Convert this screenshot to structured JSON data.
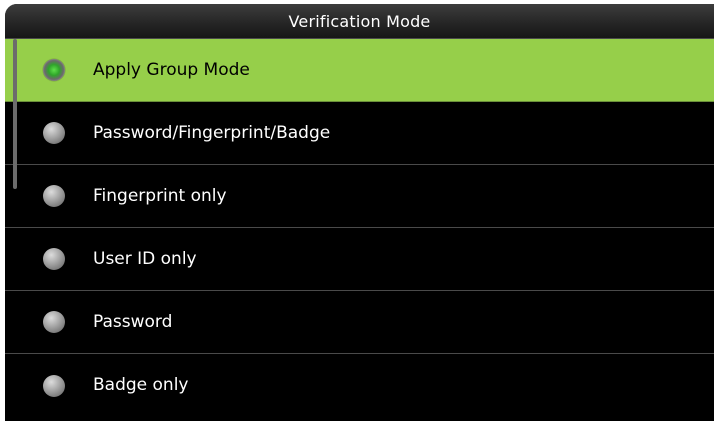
{
  "title": "Verification Mode",
  "accent_color": "#96cf4a",
  "options": [
    {
      "label": "Apply Group Mode",
      "selected": true
    },
    {
      "label": "Password/Fingerprint/Badge",
      "selected": false
    },
    {
      "label": "Fingerprint only",
      "selected": false
    },
    {
      "label": "User ID only",
      "selected": false
    },
    {
      "label": "Password",
      "selected": false
    },
    {
      "label": "Badge only",
      "selected": false
    }
  ],
  "icons": {
    "radio_selected": "radio-selected-icon",
    "radio_unselected": "radio-unselected-icon"
  }
}
